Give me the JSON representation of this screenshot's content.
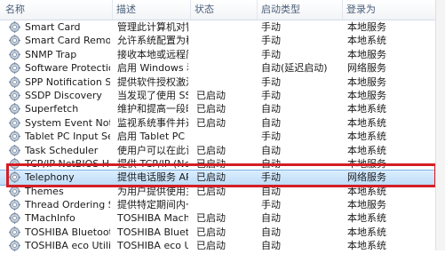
{
  "columns": [
    "名称",
    "描述",
    "状态",
    "启动类型",
    "登录为"
  ],
  "rows": [
    {
      "name": "Smart Card",
      "desc": "管理此计算机对智...",
      "status": "",
      "start": "手动",
      "logon": "本地服务"
    },
    {
      "name": "Smart Card Removal ...",
      "desc": "允许系统配置为移...",
      "status": "",
      "start": "手动",
      "logon": "本地系统"
    },
    {
      "name": "SNMP Trap",
      "desc": "接收本地或远程简...",
      "status": "",
      "start": "手动",
      "logon": "本地服务"
    },
    {
      "name": "Software Protection",
      "desc": "启用 Windows 和...",
      "status": "",
      "start": "自动(延迟启动)",
      "logon": "网络服务"
    },
    {
      "name": "SPP Notification Servi...",
      "desc": "提供软件授权激活...",
      "status": "",
      "start": "手动",
      "logon": "本地服务"
    },
    {
      "name": "SSDP Discovery",
      "desc": "当发现了使用 SS...",
      "status": "已启动",
      "start": "手动",
      "logon": "本地服务"
    },
    {
      "name": "Superfetch",
      "desc": "维护和提高一段时...",
      "status": "已启动",
      "start": "自动",
      "logon": "本地系统"
    },
    {
      "name": "System Event Notifica...",
      "desc": "监视系统事件并通...",
      "status": "已启动",
      "start": "自动",
      "logon": "本地系统"
    },
    {
      "name": "Tablet PC Input Service",
      "desc": "启用 Tablet PC 笔...",
      "status": "",
      "start": "手动",
      "logon": "本地系统"
    },
    {
      "name": "Task Scheduler",
      "desc": "使用户可以在此计...",
      "status": "已启动",
      "start": "自动",
      "logon": "本地系统"
    },
    {
      "name": "TCP/IP NetBIOS Helper",
      "desc": "提供 TCP/IP (Net...",
      "status": "已启动",
      "start": "自动",
      "logon": "本地服务"
    },
    {
      "name": "Telephony",
      "desc": "提供电话服务 API...",
      "status": "已启动",
      "start": "手动",
      "logon": "网络服务"
    },
    {
      "name": "Themes",
      "desc": "为用户提供使用主...",
      "status": "已启动",
      "start": "自动",
      "logon": "本地系统"
    },
    {
      "name": "Thread Ordering Ser...",
      "desc": "提供特定期间内一...",
      "status": "",
      "start": "手动",
      "logon": "本地服务"
    },
    {
      "name": "TMachInfo",
      "desc": "TOSHIBA Machi...",
      "status": "已启动",
      "start": "自动",
      "logon": "本地系统"
    },
    {
      "name": "TOSHIBA Bluetooth S...",
      "desc": "TOSHIBA Blueto...",
      "status": "已启动",
      "start": "自动",
      "logon": "本地系统"
    },
    {
      "name": "TOSHIBA eco Utility S...",
      "desc": "TOSHIBA eco Ut...",
      "status": "已启动",
      "start": "自动",
      "logon": "本地系统"
    }
  ],
  "selected_row": "Telephony",
  "colors": {
    "highlight_border": "#d41e24",
    "selection": "#bfdcf7",
    "header_text": "#4c607a"
  }
}
